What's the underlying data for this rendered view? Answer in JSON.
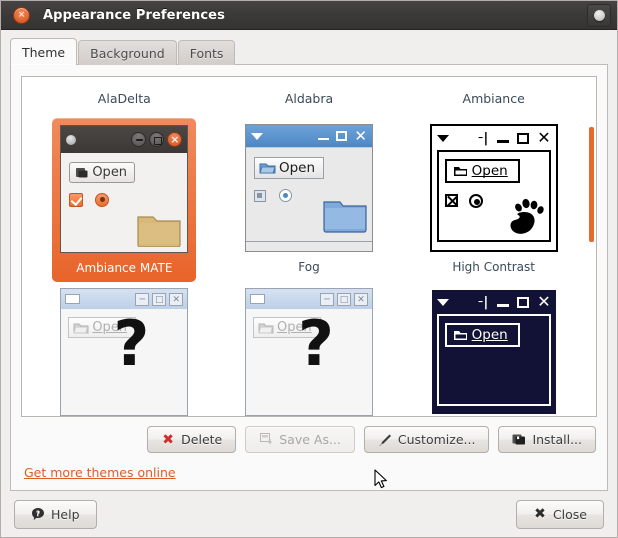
{
  "window": {
    "title": "Appearance Preferences",
    "close_glyph": "×",
    "titlebar_bg": "#3c3a38",
    "accent": "#e8682c"
  },
  "tabs": [
    {
      "label": "Theme",
      "active": true
    },
    {
      "label": "Background",
      "active": false
    },
    {
      "label": "Fonts",
      "active": false
    }
  ],
  "theme_list": {
    "columns": [
      "AlaDelta",
      "Aldabra",
      "Ambiance"
    ],
    "row1": [
      {
        "caption": "Ambiance MATE",
        "selected": true,
        "open_label": "Open"
      },
      {
        "caption": "Fog",
        "selected": false,
        "open_label": "Open"
      },
      {
        "caption": "High Contrast",
        "selected": false,
        "open_label": "Open"
      }
    ],
    "row2": [
      {
        "caption": "",
        "selected": false,
        "open_label": "Open",
        "loading_glyph": "?"
      },
      {
        "caption": "",
        "selected": false,
        "open_label": "Open",
        "loading_glyph": "?"
      },
      {
        "caption": "",
        "selected": false,
        "open_label": "Open"
      }
    ],
    "scrollbar_color": "#e8682c"
  },
  "actions": {
    "delete": {
      "label": "Delete",
      "icon": "✖",
      "enabled": true
    },
    "save_as": {
      "label": "Save As...",
      "icon": "⧉",
      "enabled": false
    },
    "customize": {
      "label": "Customize...",
      "icon": "✎",
      "enabled": true
    },
    "install": {
      "label": "Install...",
      "icon": "▣",
      "enabled": true
    }
  },
  "link": {
    "label": "Get more themes online",
    "color": "#dd5d22"
  },
  "footer": {
    "help": {
      "label": "Help",
      "icon": "?"
    },
    "close": {
      "label": "Close",
      "icon": "✖"
    }
  }
}
